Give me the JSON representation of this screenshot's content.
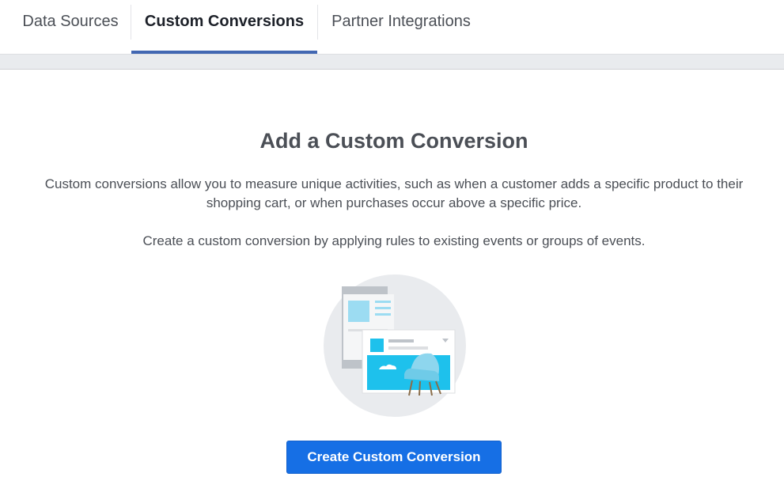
{
  "tabs": [
    {
      "label": "Data Sources",
      "active": false
    },
    {
      "label": "Custom Conversions",
      "active": true
    },
    {
      "label": "Partner Integrations",
      "active": false
    }
  ],
  "empty_state": {
    "title": "Add a Custom Conversion",
    "description": "Custom conversions allow you to measure unique activities, such as when a customer adds a specific product to their shopping cart, or when purchases occur above a specific price.",
    "instruction": "Create a custom conversion by applying rules to existing events or groups of events.",
    "illustration_icon": "product-page-chair-illustration",
    "cta_label": "Create Custom Conversion"
  },
  "colors": {
    "accent": "#4267b2",
    "button": "#166fe5",
    "illustration_blue": "#1ec1ec",
    "band": "#e9ebee"
  }
}
